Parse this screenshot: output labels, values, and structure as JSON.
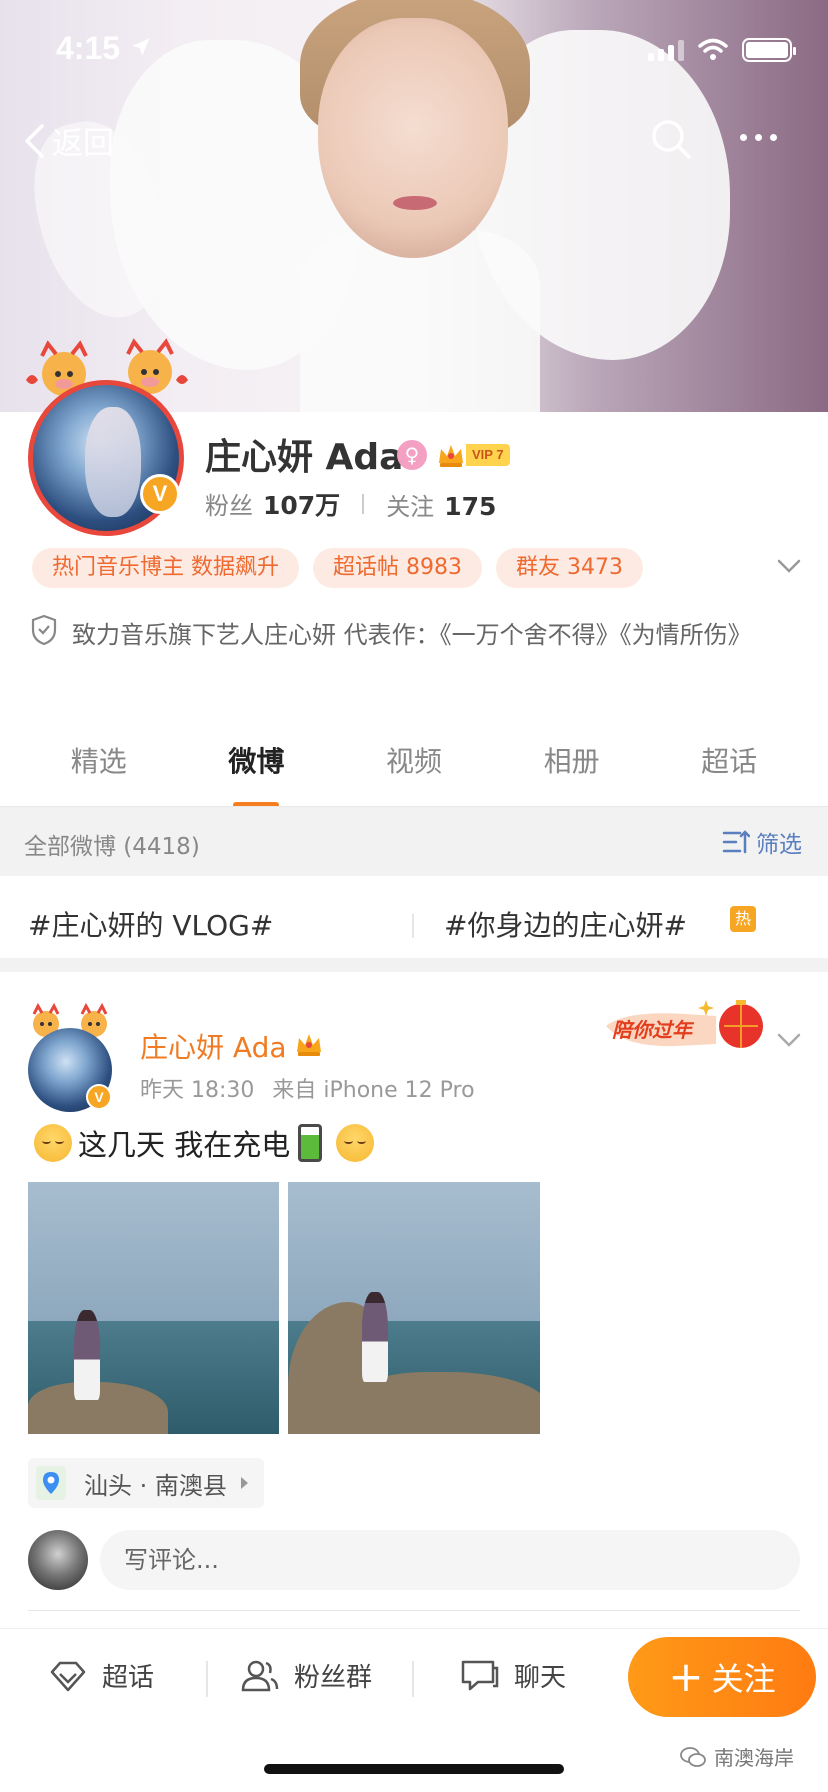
{
  "status_bar": {
    "time": "4:15"
  },
  "nav": {
    "back_label": "返回"
  },
  "profile": {
    "name": "庄心妍 Ada",
    "vip_label": "VIP 7",
    "fans_label": "粉丝",
    "fans_count": "107万",
    "following_label": "关注",
    "following_count": "175",
    "tags": [
      "热门音乐博主 数据飙升",
      "超话帖 8983",
      "群友 3473"
    ],
    "bio": "致力音乐旗下艺人庄心妍 代表作：《一万个舍不得》《为情所伤》"
  },
  "tabs": [
    "精选",
    "微博",
    "视频",
    "相册",
    "超话"
  ],
  "active_tab": "微博",
  "filter": {
    "count_label": "全部微博 (4418)",
    "button_label": "筛选"
  },
  "topics": {
    "first": "#庄心妍的 VLOG#",
    "second": "#你身边的庄心妍#",
    "hot_badge": "热"
  },
  "post": {
    "author": "庄心妍 Ada",
    "time": "昨天 18:30",
    "source": "来自 iPhone 12 Pro",
    "badge_text": "陪你过年",
    "text": "这几天 我在充电",
    "location": "汕头 · 南澳县",
    "comment_placeholder": "写评论..."
  },
  "bottom_bar": {
    "supertopic_label": "超话",
    "fan_group_label": "粉丝群",
    "chat_label": "聊天",
    "follow_label": "关注"
  },
  "watermark": "南澳海岸",
  "colors": {
    "accent_orange": "#ff8a16",
    "name_orange": "#f07b22",
    "tag_bg": "#fdeae2",
    "link_blue": "#5a7fbe"
  }
}
